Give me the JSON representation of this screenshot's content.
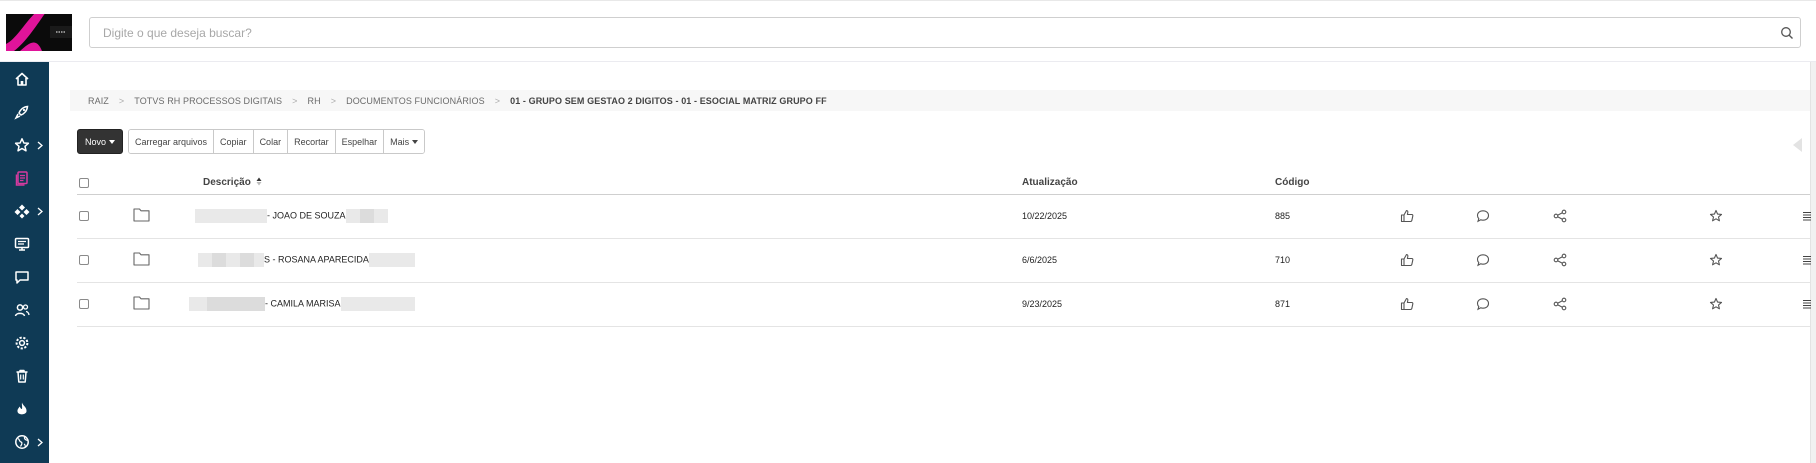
{
  "header": {
    "search_placeholder": "Digite o que deseja buscar?",
    "logo_icon": "brand-logo",
    "search_icon": "search-icon"
  },
  "sidebar": {
    "bg_color": "#0f3a55",
    "active_color": "#d63aa0",
    "items": [
      {
        "icon": "home-icon",
        "has_submenu": false,
        "active": false
      },
      {
        "icon": "rocket-icon",
        "has_submenu": false,
        "active": false
      },
      {
        "icon": "star-icon",
        "has_submenu": true,
        "active": false
      },
      {
        "icon": "documents-icon",
        "has_submenu": false,
        "active": true
      },
      {
        "icon": "workflow-icon",
        "has_submenu": true,
        "active": false
      },
      {
        "icon": "monitor-icon",
        "has_submenu": false,
        "active": false
      },
      {
        "icon": "chat-icon",
        "has_submenu": false,
        "active": false
      },
      {
        "icon": "users-icon",
        "has_submenu": false,
        "active": false
      },
      {
        "icon": "gear-icon",
        "has_submenu": false,
        "active": false
      },
      {
        "icon": "trash-icon",
        "has_submenu": false,
        "active": false
      },
      {
        "icon": "fire-icon",
        "has_submenu": false,
        "active": false
      },
      {
        "icon": "globe-icon",
        "has_submenu": true,
        "active": false
      }
    ]
  },
  "breadcrumb": [
    "RAIZ",
    "TOTVS RH PROCESSOS DIGITAIS",
    "RH",
    "DOCUMENTOS FUNCIONÁRIOS",
    "01 - GRUPO SEM GESTAO 2 DIGITOS - 01 - ESOCIAL MATRIZ GRUPO FF"
  ],
  "toolbar": {
    "new_label": "Novo",
    "upload_label": "Carregar arquivos",
    "copy_label": "Copiar",
    "paste_label": "Colar",
    "cut_label": "Recortar",
    "mirror_label": "Espelhar",
    "more_label": "Mais"
  },
  "table": {
    "columns": {
      "description": "Descrição",
      "updated": "Atualização",
      "code": "Código"
    },
    "rows": [
      {
        "description": "- JOAO DE SOUZA",
        "updated": "10/22/2025",
        "code": "885"
      },
      {
        "description": "S - ROSANA APARECIDA",
        "updated": "6/6/2025",
        "code": "710"
      },
      {
        "description": "- CAMILA MARISA",
        "updated": "9/23/2025",
        "code": "871"
      }
    ],
    "row_actions": [
      "like-icon",
      "comment-icon",
      "share-icon",
      "star-icon",
      "menu-icon"
    ]
  }
}
